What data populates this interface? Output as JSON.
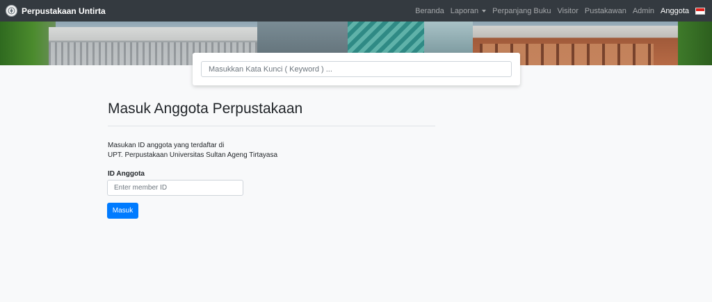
{
  "navbar": {
    "brand": "Perpustakaan Untirta",
    "items": [
      {
        "label": "Beranda"
      },
      {
        "label": "Laporan"
      },
      {
        "label": "Perpanjang Buku"
      },
      {
        "label": "Visitor"
      },
      {
        "label": "Pustakawan"
      },
      {
        "label": "Admin"
      },
      {
        "label": "Anggota"
      }
    ],
    "active_item": "Anggota"
  },
  "search": {
    "placeholder": "Masukkan Kata Kunci ( Keyword ) ..."
  },
  "login": {
    "title": "Masuk Anggota Perpustakaan",
    "description_line1": "Masukan ID anggota yang terdaftar di",
    "description_line2": "UPT. Perpustakaan Universitas Sultan Ageng Tirtayasa",
    "field_label": "ID Anggota",
    "field_placeholder": "Enter member ID",
    "submit_label": "Masuk"
  },
  "colors": {
    "navbar_bg": "#343a40",
    "primary": "#007bff",
    "page_bg": "#f8f9fa"
  },
  "icons": {
    "brand": "university-logo-icon",
    "dropdown": "caret-down-icon",
    "language": "indonesia-flag-icon"
  }
}
